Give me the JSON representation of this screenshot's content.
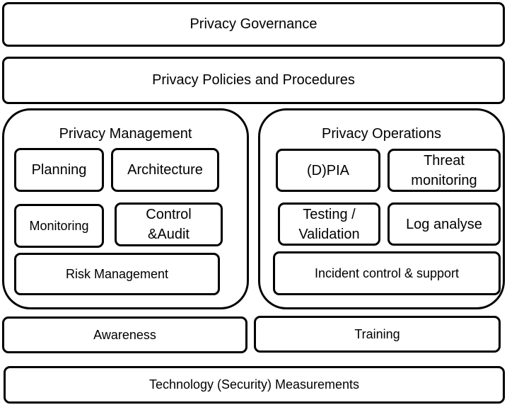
{
  "layers": {
    "governance": "Privacy Governance",
    "policies": "Privacy Policies and Procedures",
    "awareness": "Awareness",
    "training": "Training",
    "technology": "Technology (Security) Measurements"
  },
  "management": {
    "title": "Privacy Management",
    "planning": "Planning",
    "architecture": "Architecture",
    "monitoring": "Monitoring",
    "control_audit": [
      "Control",
      "&Audit"
    ],
    "risk": "Risk Management"
  },
  "operations": {
    "title": "Privacy Operations",
    "dpia": "(D)PIA",
    "threat": [
      "Threat",
      "monitoring"
    ],
    "testing": [
      "Testing /",
      "Validation"
    ],
    "log": "Log analyse",
    "incident": "Incident control & support"
  }
}
